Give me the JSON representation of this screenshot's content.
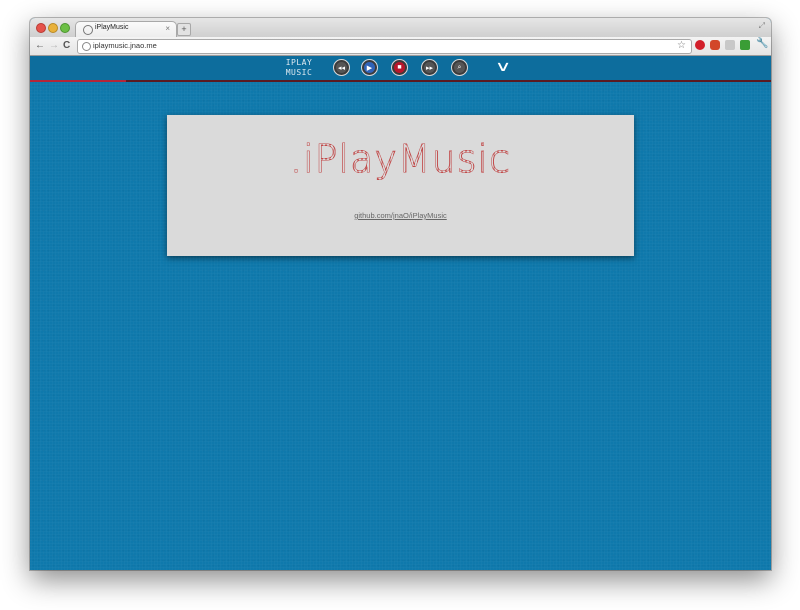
{
  "browser": {
    "tab_title": "iPlayMusic",
    "tab_close": "×",
    "new_tab": "+",
    "url": "iplaymusic.jnao.me",
    "nav": {
      "back": "←",
      "forward": "→",
      "reload": "C"
    },
    "icons": {
      "star": "☆",
      "wrench": "🔧",
      "resize": "⤢"
    }
  },
  "player": {
    "brand_line1": "IPLAY",
    "brand_line2": "MUSIC",
    "buttons": {
      "prev": "◂◂",
      "play": "▶",
      "stop": "■",
      "next": "▸▸",
      "search": "⌕"
    },
    "chevron": "∨",
    "progress_fraction": 0.13,
    "colors": {
      "play": "#2f63b8",
      "stop": "#b8162b",
      "progress": "#b3263a"
    }
  },
  "card": {
    "logo_text": ".iPlayMusic",
    "link_text": "github.com/jnaO/iPlayMusic"
  },
  "theme": {
    "page_bg": "#0f79ac",
    "card_bg": "#dadada"
  }
}
